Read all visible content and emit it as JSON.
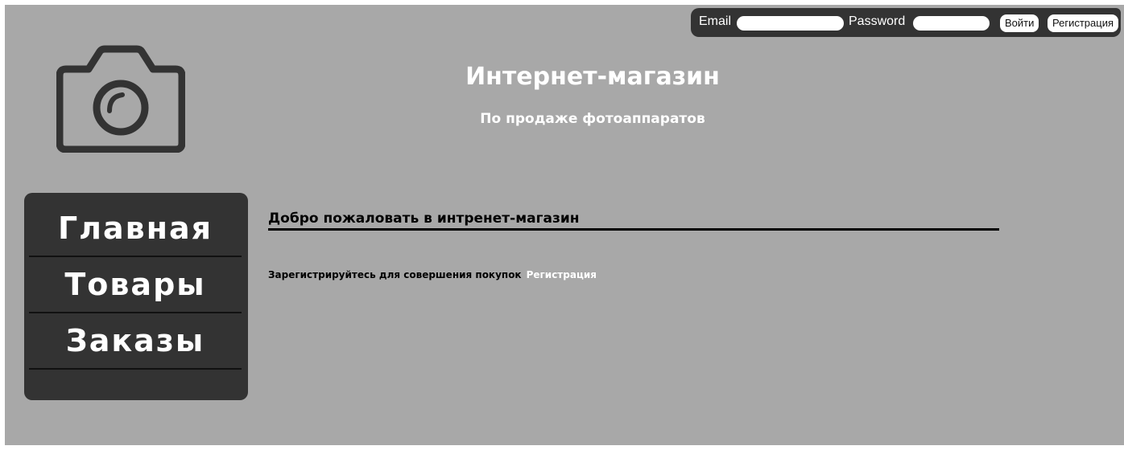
{
  "login": {
    "email_label": "Email",
    "email_value": "",
    "password_label": "Password",
    "password_value": "",
    "login_button": "Войти",
    "register_button": "Регистрация"
  },
  "header": {
    "logo_icon": "camera-icon",
    "title": "Интернет-магазин",
    "subtitle": "По продаже фотоаппаратов"
  },
  "sidebar": {
    "items": [
      {
        "label": "Главная"
      },
      {
        "label": "Товары"
      },
      {
        "label": "Заказы"
      }
    ]
  },
  "main": {
    "welcome": "Добро пожаловать в интренет-магазин",
    "register_prompt": "Зарегистрируйтесь для совершения покупок",
    "register_link": "Регистрация"
  },
  "colors": {
    "background": "#a8a8a8",
    "panel": "#333333",
    "text_light": "#ffffff"
  }
}
